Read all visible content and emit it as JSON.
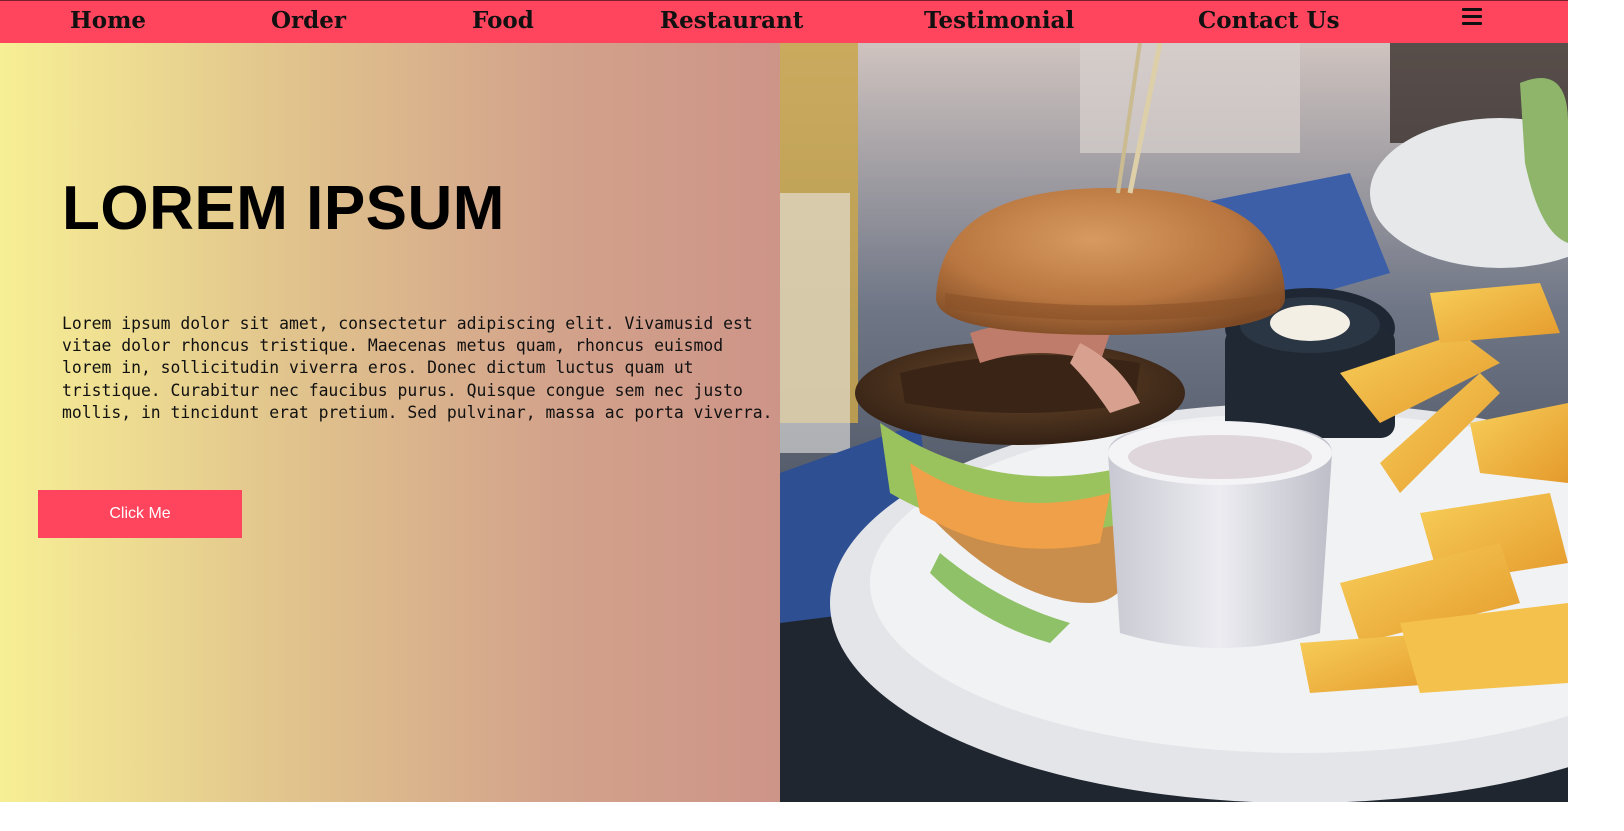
{
  "nav": {
    "items": [
      "Home",
      "Order",
      "Food",
      "Restaurant",
      "Testimonial",
      "Contact Us"
    ],
    "menu_icon": "hamburger-menu-icon"
  },
  "hero": {
    "title": "LOREM IPSUM",
    "paragraph": "Lorem ipsum dolor sit amet, consectetur adipiscing elit. Vivamusid est vitae dolor rhoncus tristique. Maecenas metus quam, rhoncus euismod lorem in, sollicitudin viverra eros. Donec dictum luctus quam ut tristique. Curabitur nec faucibus purus. Quisque congue sem nec justo mollis, in tincidunt erat pretium. Sed pulvinar, massa ac porta viverra.",
    "button_label": "Click Me",
    "image_subject": "burger-with-fries-photo"
  },
  "colors": {
    "accent": "#ff445d",
    "gradient_start": "#f7ef95",
    "gradient_end": "#cd9488",
    "text": "#111111"
  }
}
